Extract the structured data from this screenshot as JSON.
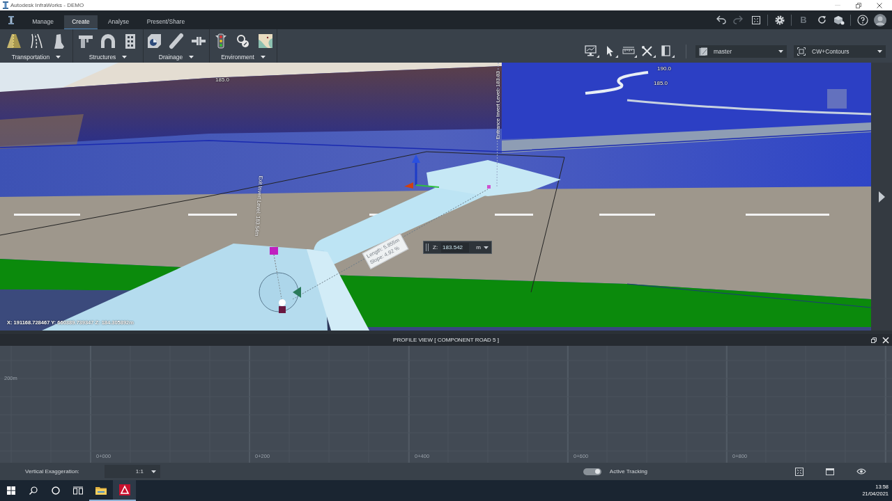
{
  "window": {
    "title": "Autodesk InfraWorks - DEMO"
  },
  "menu_tabs": [
    {
      "label": "Manage",
      "selected": false
    },
    {
      "label": "Create",
      "selected": true
    },
    {
      "label": "Analyse",
      "selected": false
    },
    {
      "label": "Present/Share",
      "selected": false
    }
  ],
  "quick_access": {
    "undo": {
      "disabled": false
    },
    "redo": {
      "disabled": true
    },
    "b_label": "B"
  },
  "ribbon_groups": [
    {
      "label": "Transportation"
    },
    {
      "label": "Structures"
    },
    {
      "label": "Drainage"
    },
    {
      "label": "Environment"
    }
  ],
  "proposal_dropdown": {
    "value": "master"
  },
  "style_dropdown": {
    "value": "CW+Contours"
  },
  "viewport": {
    "contour_labels": [
      "185.0",
      "190.0",
      "185.0"
    ],
    "entrance_invert_label": "Entrance Invert Level: 183.83",
    "exit_invert_label": "Exit Invert Level: 183.54m",
    "pipe_tooltip": {
      "length": "Length: 5.855m",
      "slope": "Slope: 4.92 %"
    },
    "z_input": {
      "label": "Z:",
      "value": "183.542",
      "unit": "m"
    },
    "cursor_coordinates": "X: 191168.728467 Y: 660389.739347 Z: 184.305892m"
  },
  "profile_view": {
    "title": "PROFILE VIEW [ COMPONENT ROAD 5 ]",
    "y_labels": [
      "200m"
    ],
    "x_labels": [
      "0+000",
      "0+200",
      "0+400",
      "0+600",
      "0+800"
    ]
  },
  "profile_toolbar": {
    "exaggeration_label": "Vertical Exaggeration:",
    "exaggeration_value": "1:1",
    "tracking": {
      "label": "Active Tracking",
      "on": true
    }
  },
  "taskbar": {
    "time": "13:58",
    "date": "21/04/2021"
  }
}
